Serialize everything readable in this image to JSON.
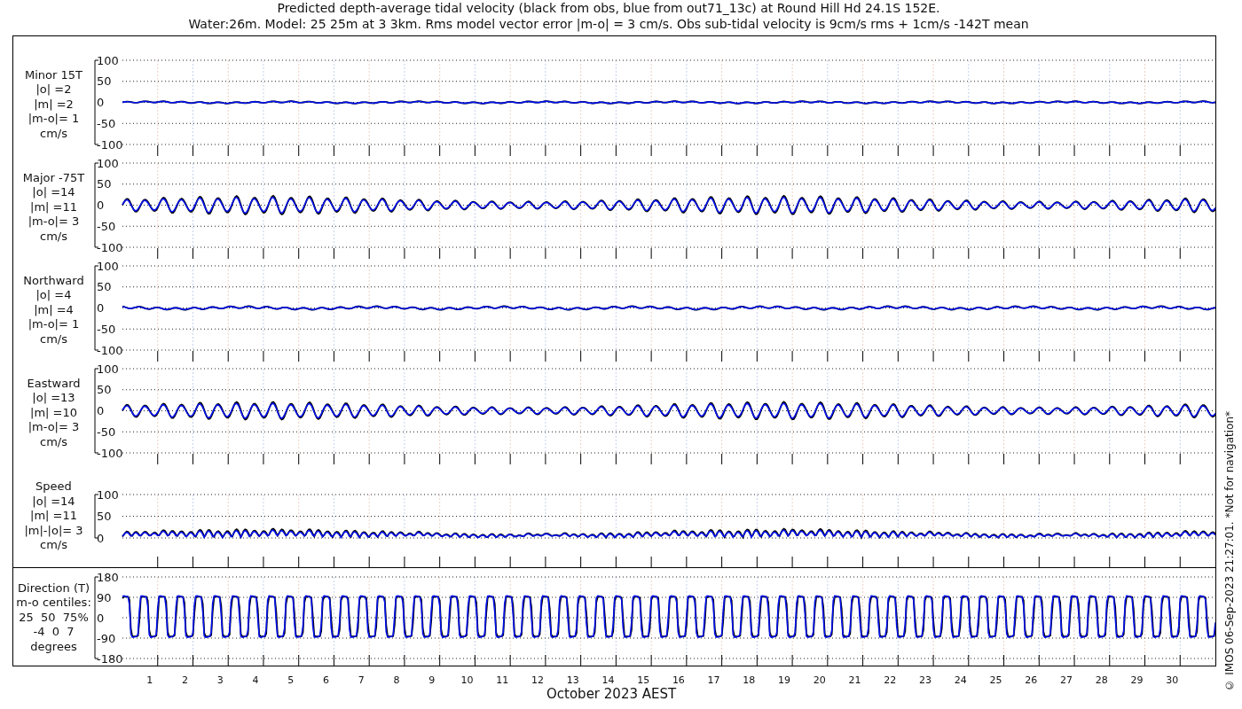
{
  "title": [
    "Predicted depth-average tidal velocity (black from obs, blue from out71_13c) at Round Hill Hd 24.1S 152E.",
    "Water:26m. Model: 25 25m at 3 3km. Rms model vector error |m-o| = 3 cm/s. Obs sub-tidal velocity is 9cm/s rms + 1cm/s -142T mean"
  ],
  "panels": [
    {
      "kind": "velocity",
      "label": [
        "Minor 15T",
        "|o| =2",
        "|m| =2",
        "|m-o|= 1",
        "cm/s"
      ],
      "yticks": [
        "100",
        "50",
        "0",
        "-50",
        "-100"
      ]
    },
    {
      "kind": "velocity",
      "label": [
        "Major -75T",
        "|o| =14",
        "|m| =11",
        "|m-o|= 3",
        "cm/s"
      ],
      "yticks": [
        "100",
        "50",
        "0",
        "-50",
        "-100"
      ]
    },
    {
      "kind": "velocity",
      "label": [
        "Northward",
        "|o| =4",
        "|m| =4",
        "|m-o|= 1",
        "cm/s"
      ],
      "yticks": [
        "100",
        "50",
        "0",
        "-50",
        "-100"
      ]
    },
    {
      "kind": "velocity",
      "label": [
        "Eastward",
        "|o| =13",
        "|m| =10",
        "|m-o|= 3",
        "cm/s"
      ],
      "yticks": [
        "100",
        "50",
        "0",
        "-50",
        "-100"
      ]
    },
    {
      "kind": "speed",
      "label": [
        "Speed",
        "|o| =14",
        "|m| =11",
        "|m|-|o|= 3",
        "cm/s"
      ],
      "yticks": [
        "100",
        "50",
        "0"
      ]
    },
    {
      "kind": "direction",
      "label": [
        "Direction (T)",
        "m-o centiles:",
        "25  50  75%",
        "-4  0  7",
        "degrees"
      ],
      "yticks": [
        "180",
        "90",
        "0",
        "-90",
        "-180"
      ]
    }
  ],
  "xaxis": {
    "ticks": [
      "1",
      "2",
      "3",
      "4",
      "5",
      "6",
      "7",
      "8",
      "9",
      "10",
      "11",
      "12",
      "13",
      "14",
      "15",
      "16",
      "17",
      "18",
      "19",
      "20",
      "21",
      "22",
      "23",
      "24",
      "25",
      "26",
      "27",
      "28",
      "29",
      "30"
    ],
    "label": "October 2023 AEST"
  },
  "credit": "© IMOS 06-Sep-2023 21:27:01. *Not for navigation*"
}
